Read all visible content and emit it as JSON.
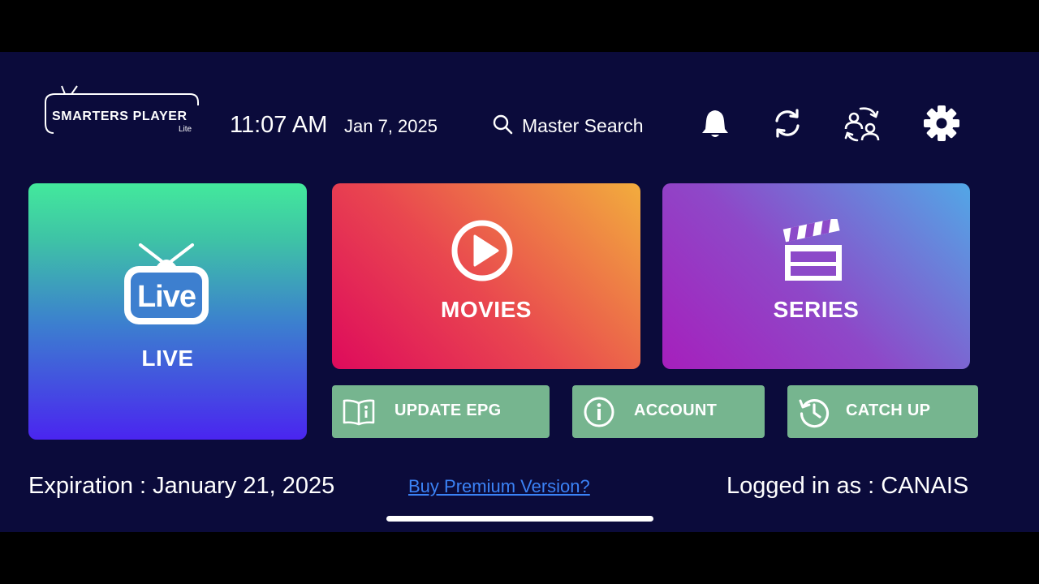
{
  "header": {
    "logo_name": "SMARTERS PLAYER",
    "logo_sub": "Lite",
    "time": "11:07 AM",
    "date": "Jan 7, 2025",
    "search_label": "Master Search",
    "icons": [
      "bell-icon",
      "refresh-icon",
      "switch-user-icon",
      "gear-icon"
    ]
  },
  "tiles": {
    "live": {
      "label": "LIVE",
      "icon_text": "Live",
      "icon": "tv-icon"
    },
    "movies": {
      "label": "MOVIES",
      "icon": "play-circle-icon"
    },
    "series": {
      "label": "SERIES",
      "icon": "clapperboard-icon"
    }
  },
  "buttons": {
    "update_epg": {
      "label": "UPDATE EPG",
      "icon": "book-info-icon"
    },
    "account": {
      "label": "ACCOUNT",
      "icon": "info-circle-icon"
    },
    "catch_up": {
      "label": "CATCH UP",
      "icon": "history-clock-icon"
    }
  },
  "footer": {
    "expiration": "Expiration : January 21, 2025",
    "premium_link": "Buy Premium Version?",
    "logged_in": "Logged in as : CANAIS"
  },
  "colors": {
    "background": "#0b0b3b",
    "button_green": "#76b58f",
    "link_blue": "#3b82f6"
  }
}
